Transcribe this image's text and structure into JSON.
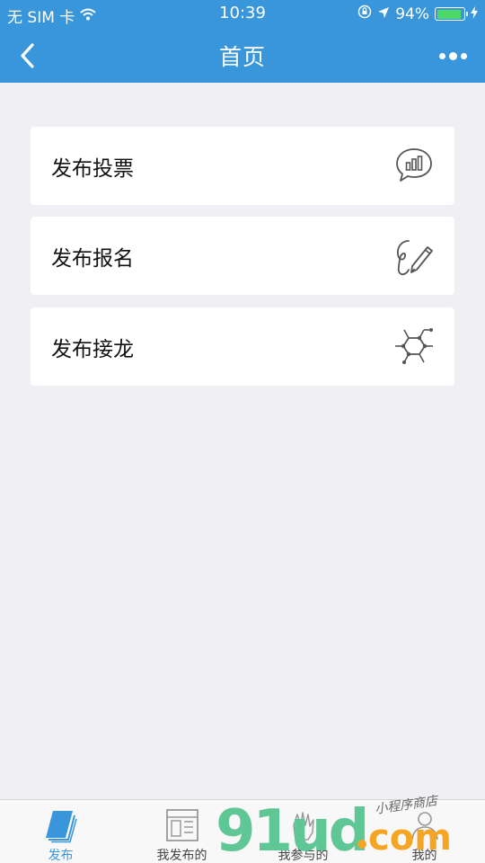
{
  "status_bar": {
    "carrier": "无 SIM 卡",
    "time": "10:39",
    "battery_percent": "94%",
    "battery_level": 0.94,
    "battery_color": "#4cd964"
  },
  "nav": {
    "title": "首页",
    "color": "#3a96db"
  },
  "cards": [
    {
      "label": "发布投票",
      "icon": "poll-chart-icon"
    },
    {
      "label": "发布报名",
      "icon": "pen-signature-icon"
    },
    {
      "label": "发布接龙",
      "icon": "hexagon-network-icon"
    }
  ],
  "tabs": [
    {
      "label": "发布",
      "icon": "book-icon",
      "active": true
    },
    {
      "label": "我发布的",
      "icon": "layout-icon",
      "active": false
    },
    {
      "label": "我参与的",
      "icon": "hand-icon",
      "active": false
    },
    {
      "label": "我的",
      "icon": "person-icon",
      "active": false
    }
  ],
  "watermark": {
    "main": "91ud",
    "tld": "com",
    "tagline": "小程序商店"
  }
}
